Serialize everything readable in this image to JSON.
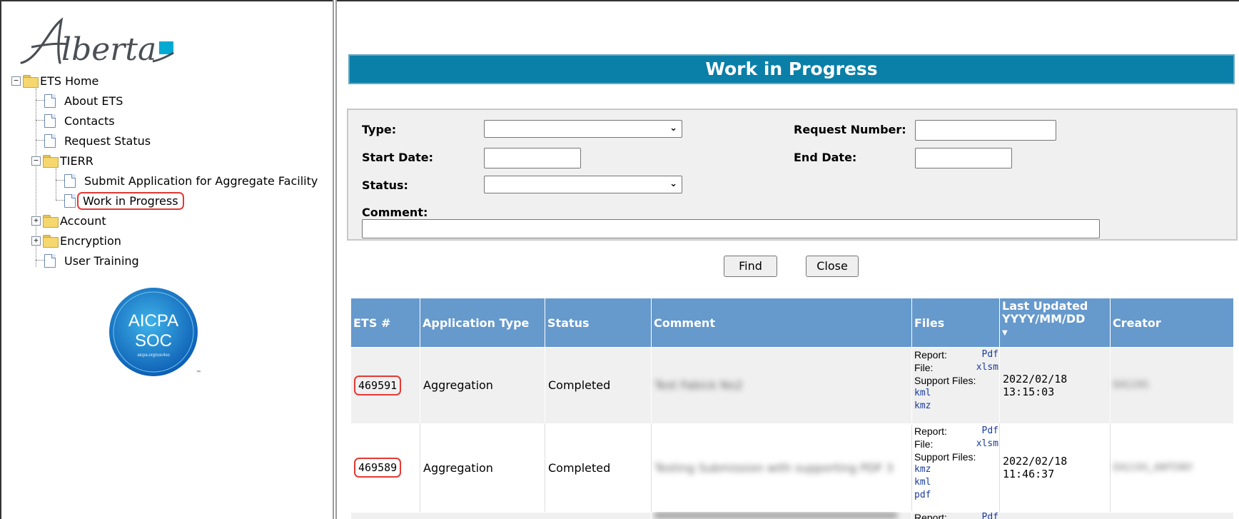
{
  "logo": {
    "text": "Alberta"
  },
  "nav": {
    "items": [
      {
        "label": "ETS Home"
      },
      {
        "label": "About ETS"
      },
      {
        "label": "Contacts"
      },
      {
        "label": "Request Status"
      },
      {
        "label": "TIERR"
      },
      {
        "label": "Submit Application for Aggregate Facility"
      },
      {
        "label": "Work in Progress"
      },
      {
        "label": "Account"
      },
      {
        "label": "Encryption"
      },
      {
        "label": "User Training"
      }
    ]
  },
  "badge": {
    "line1": "AICPA",
    "line2": "SOC",
    "sub": "aicpa.org/soc4so"
  },
  "page_title": "Work in Progress",
  "filters": {
    "type_label": "Type:",
    "request_number_label": "Request Number:",
    "start_date_label": "Start Date:",
    "end_date_label": "End Date:",
    "status_label": "Status:",
    "comment_label": "Comment:"
  },
  "buttons": {
    "find": "Find",
    "close": "Close"
  },
  "grid": {
    "headers": [
      "ETS #",
      "Application Type",
      "Status",
      "Comment",
      "Files",
      "Last Updated YYYY/MM/DD",
      "Creator"
    ],
    "rows": [
      {
        "ets": "469591",
        "type": "Aggregation",
        "status": "Completed",
        "comment": "Test Fabick No2",
        "report_label": "Report:",
        "report_link": "Pdf",
        "file_label": "File:",
        "file_link": "xlsm",
        "support_label": "Support Files:",
        "support_links": [
          "kml",
          "kmz"
        ],
        "date": "2022/02/18",
        "time": "13:15:03",
        "creator": "EA1191"
      },
      {
        "ets": "469589",
        "type": "Aggregation",
        "status": "Completed",
        "comment": "Testing Submission with supporting PDF 3",
        "report_label": "Report:",
        "report_link": "Pdf",
        "file_label": "File:",
        "file_link": "xlsm",
        "support_label": "Support Files:",
        "support_links": [
          "kmz",
          "kml",
          "pdf"
        ],
        "date": "2022/02/18",
        "time": "11:46:37",
        "creator": "EA1191_ANTONY"
      },
      {
        "report_label": "Report:",
        "report_link": "Pdf"
      }
    ]
  },
  "colors": {
    "title_bar": "#0a7fa8",
    "grid_header": "#6699cc",
    "highlight": "#e53935"
  }
}
